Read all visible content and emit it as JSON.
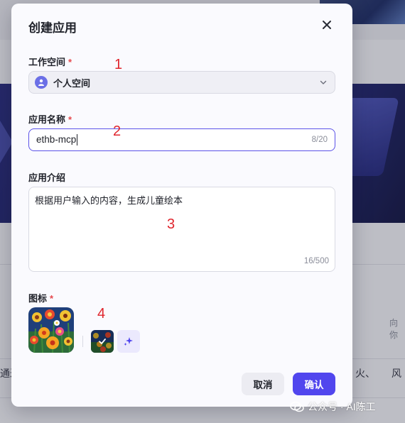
{
  "modal": {
    "title": "创建应用",
    "workspace": {
      "label": "工作空间",
      "required": "*",
      "value": "个人空间"
    },
    "app_name": {
      "label": "应用名称",
      "required": "*",
      "value": "ethb-mcp",
      "counter": "8/20"
    },
    "app_intro": {
      "label": "应用介绍",
      "value": "根据用户输入的内容，生成儿童绘本",
      "counter": "16/500"
    },
    "icon": {
      "label": "图标",
      "required": "*"
    },
    "buttons": {
      "cancel": "取消",
      "confirm": "确认"
    }
  },
  "annotations": [
    "1",
    "2",
    "3",
    "4"
  ],
  "background": {
    "snippet_left": "通过",
    "snippet_right": "火、",
    "snippet_right2": "风",
    "snippet_hint": "向你"
  },
  "watermark": "公众号 · AI陈工",
  "colors": {
    "accent": "#5146ee",
    "required": "#e5484d",
    "annotation": "#e0252d"
  },
  "icons": [
    "close-icon",
    "user-icon",
    "chevron-down-icon",
    "check-icon",
    "sparkle-icon",
    "wechat-icon"
  ]
}
